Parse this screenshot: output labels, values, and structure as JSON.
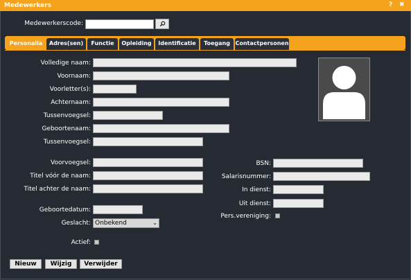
{
  "window": {
    "title": "Medewerkers",
    "help_icon": "?",
    "close_icon": "✖"
  },
  "search": {
    "label": "Medewerkerscode:",
    "value": "",
    "button_icon": "search-icon"
  },
  "tabs": [
    {
      "label": "Personalia",
      "active": true
    },
    {
      "label": "Adres(sen)",
      "active": false
    },
    {
      "label": "Functie",
      "active": false
    },
    {
      "label": "Opleiding",
      "active": false
    },
    {
      "label": "Identificatie",
      "active": false
    },
    {
      "label": "Toegang",
      "active": false
    },
    {
      "label": "Contactpersonen",
      "active": false
    }
  ],
  "fields": {
    "volledige_naam": {
      "label": "Volledige naam:",
      "value": ""
    },
    "voornaam": {
      "label": "Voornaam:",
      "value": ""
    },
    "voorletters": {
      "label": "Voorletter(s):",
      "value": ""
    },
    "achternaam": {
      "label": "Achternaam:",
      "value": ""
    },
    "tussenvoegsel1": {
      "label": "Tussenvoegsel:",
      "value": ""
    },
    "geboortenaam": {
      "label": "Geboortenaam:",
      "value": ""
    },
    "tussenvoegsel2": {
      "label": "Tussenvoegsel:",
      "value": ""
    },
    "voorvoegsel": {
      "label": "Voorvoegsel:",
      "value": ""
    },
    "titel_voor": {
      "label": "Titel vóór de naam:",
      "value": ""
    },
    "titel_achter": {
      "label": "Titel achter de naam:",
      "value": ""
    },
    "geboortedatum": {
      "label": "Geboortedatum:",
      "value": ""
    },
    "geslacht": {
      "label": "Geslacht:",
      "value": "Onbekend"
    },
    "actief": {
      "label": "Actief:",
      "checked": false
    },
    "bsn": {
      "label": "BSN:",
      "value": ""
    },
    "salarisnummer": {
      "label": "Salarisnummer:",
      "value": ""
    },
    "in_dienst": {
      "label": "In dienst:",
      "value": ""
    },
    "uit_dienst": {
      "label": "Uit dienst:",
      "value": ""
    },
    "pers_vereniging": {
      "label": "Pers.vereniging:",
      "checked": false
    }
  },
  "buttons": {
    "nieuw": "Nieuw",
    "wijzig": "Wijzig",
    "verwijder": "Verwijder"
  },
  "colors": {
    "accent": "#f5a21c",
    "background": "#262b33"
  }
}
